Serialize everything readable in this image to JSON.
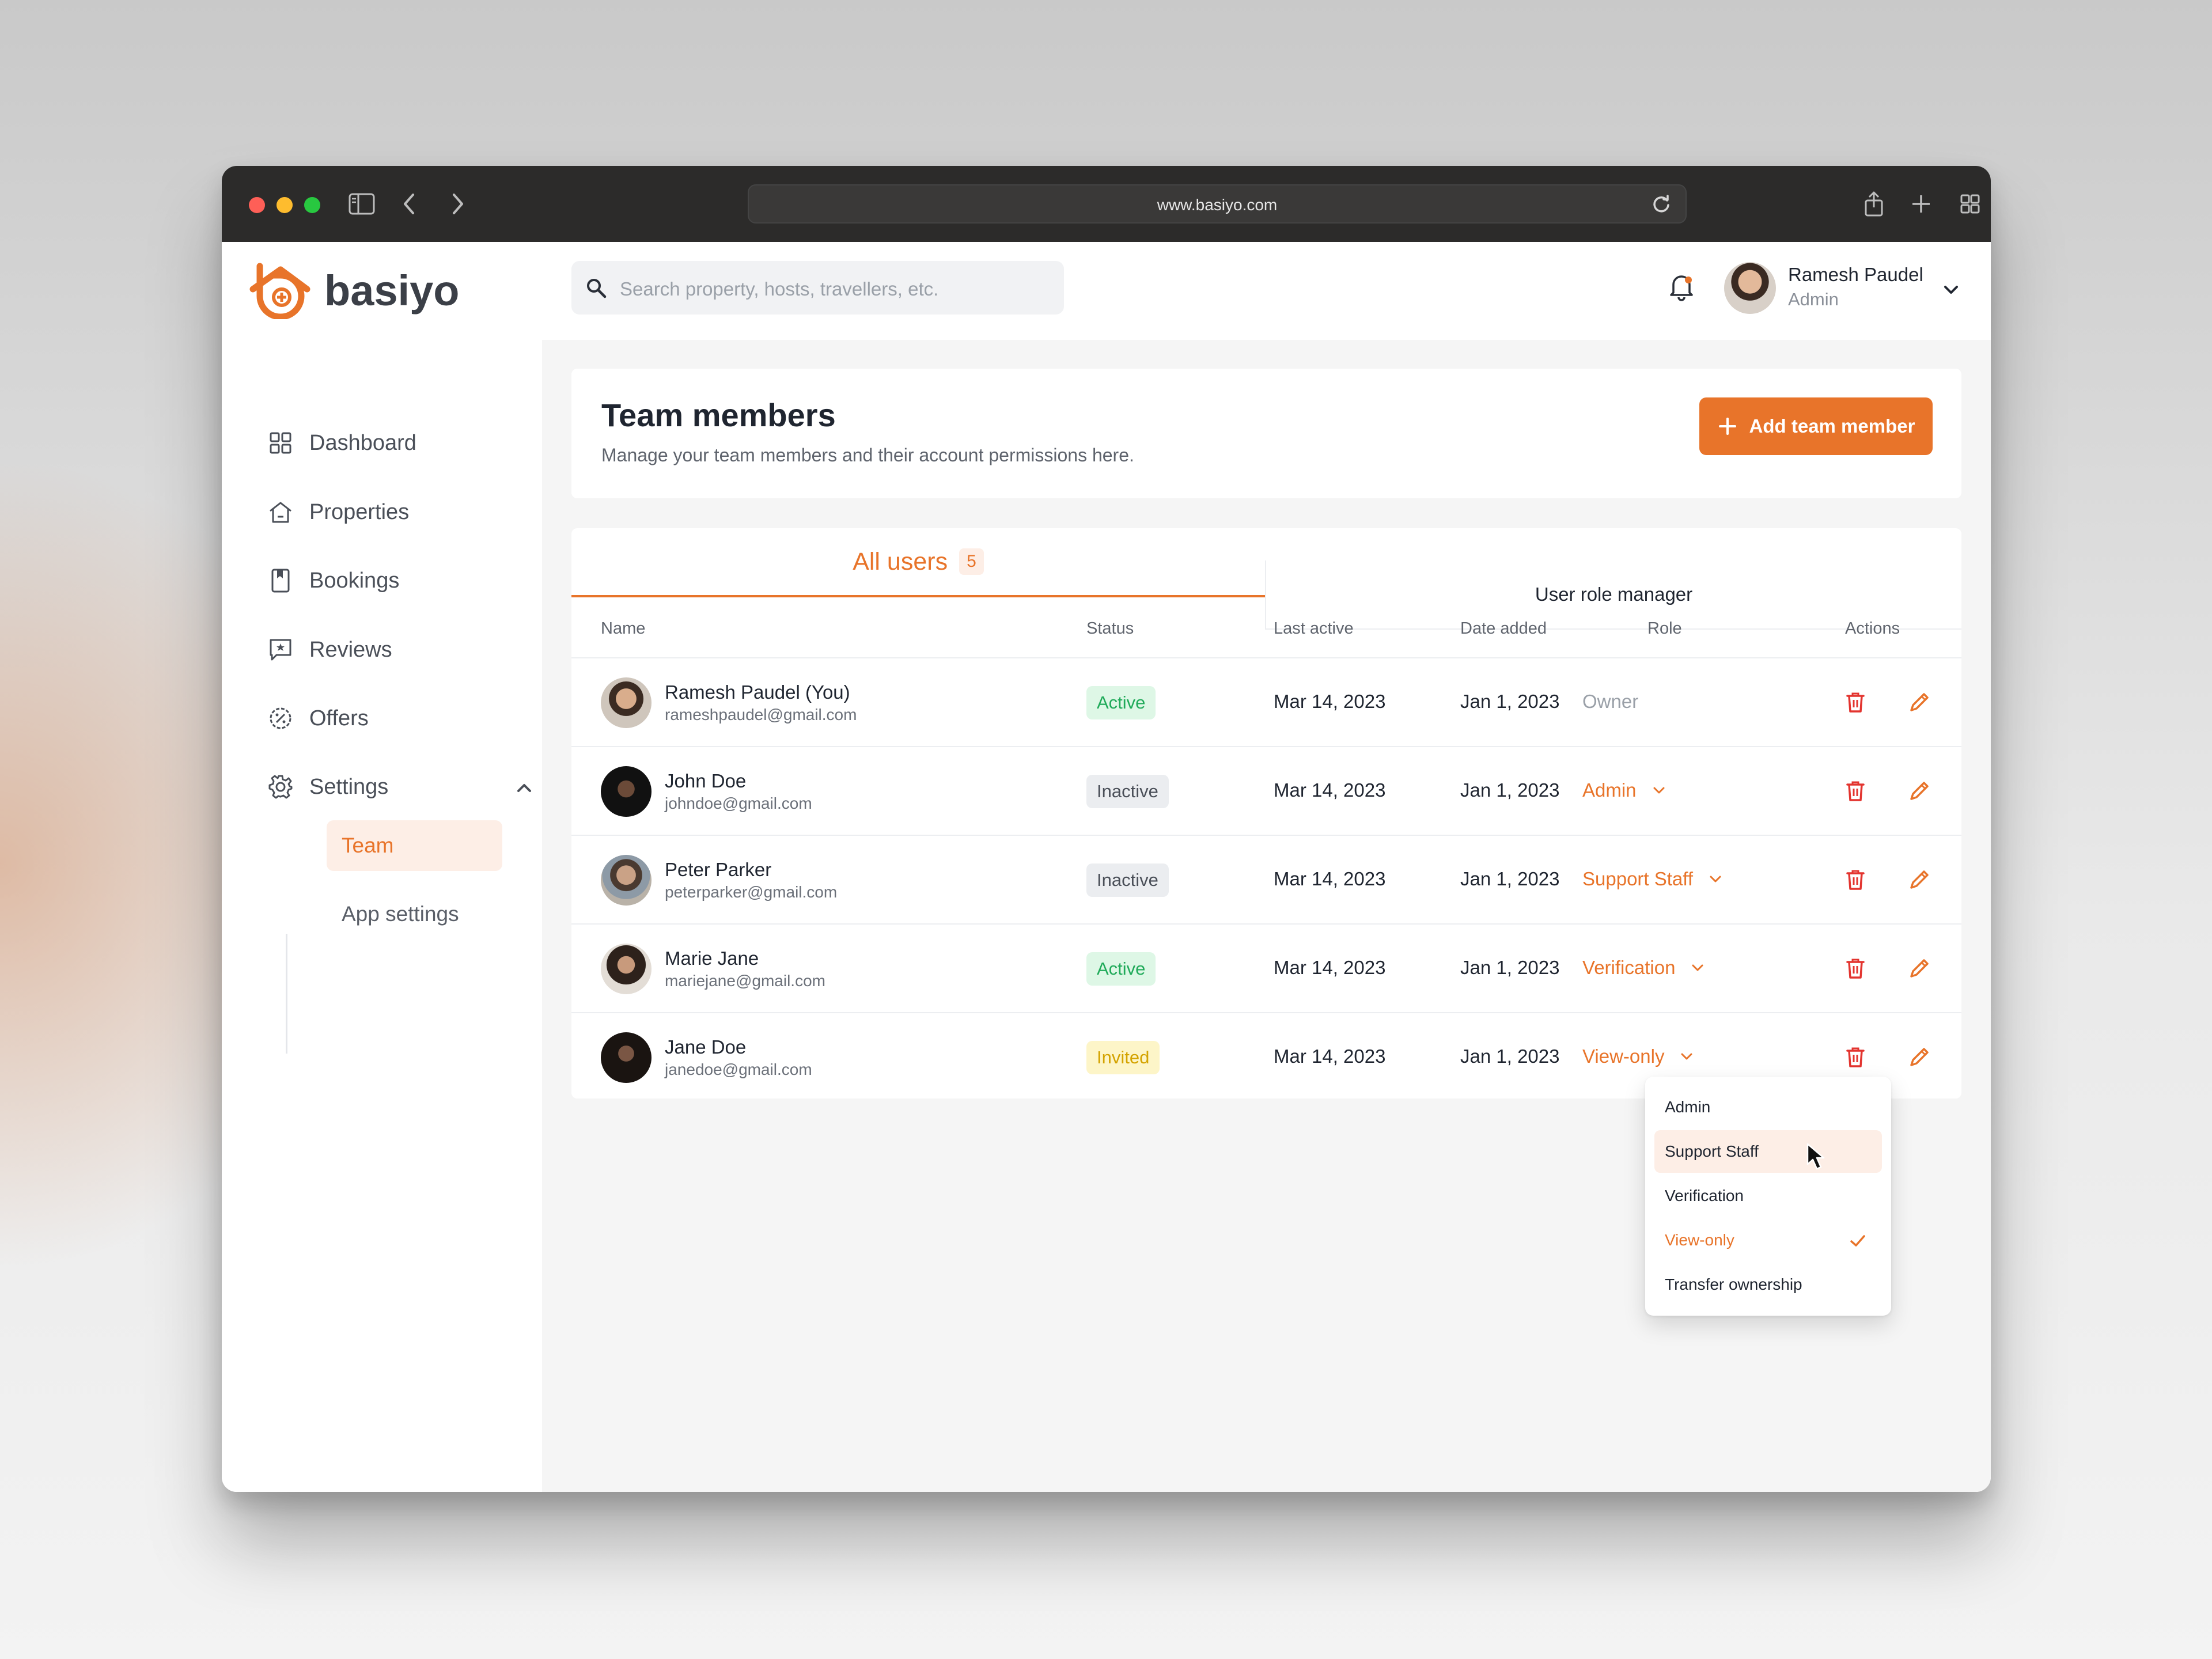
{
  "browser": {
    "url": "www.basiyo.com"
  },
  "brand": {
    "name": "basiyo",
    "accent": "#e8742a"
  },
  "search": {
    "placeholder": "Search property, hosts, travellers, etc."
  },
  "user": {
    "name": "Ramesh Paudel",
    "role": "Admin"
  },
  "sidebar": {
    "items": [
      {
        "label": "Dashboard",
        "icon": "dashboard-icon"
      },
      {
        "label": "Properties",
        "icon": "home-icon"
      },
      {
        "label": "Bookings",
        "icon": "bookmark-icon"
      },
      {
        "label": "Reviews",
        "icon": "review-icon"
      },
      {
        "label": "Offers",
        "icon": "offer-icon"
      },
      {
        "label": "Settings",
        "icon": "gear-icon"
      }
    ],
    "sub_items": [
      {
        "label": "Team",
        "active": true
      },
      {
        "label": "App settings",
        "active": false
      }
    ]
  },
  "page": {
    "title": "Team members",
    "subtitle": "Manage your team members and their account permissions here.",
    "add_button": "Add team member"
  },
  "tabs": {
    "all_users": "All users",
    "all_users_count": "5",
    "role_manager": "User role manager"
  },
  "table": {
    "headers": {
      "name": "Name",
      "status": "Status",
      "last_active": "Last active",
      "date_added": "Date added",
      "role": "Role",
      "actions": "Actions"
    },
    "rows": [
      {
        "name": "Ramesh Paudel (You)",
        "email": "rameshpaudel@gmail.com",
        "status": "Active",
        "last_active": "Mar 14, 2023",
        "date_added": "Jan 1, 2023",
        "role": "Owner"
      },
      {
        "name": "John Doe",
        "email": "johndoe@gmail.com",
        "status": "Inactive",
        "last_active": "Mar 14, 2023",
        "date_added": "Jan 1, 2023",
        "role": "Admin"
      },
      {
        "name": "Peter Parker",
        "email": "peterparker@gmail.com",
        "status": "Inactive",
        "last_active": "Mar 14, 2023",
        "date_added": "Jan 1, 2023",
        "role": "Support Staff"
      },
      {
        "name": "Marie Jane",
        "email": "mariejane@gmail.com",
        "status": "Active",
        "last_active": "Mar 14, 2023",
        "date_added": "Jan 1, 2023",
        "role": "Verification"
      },
      {
        "name": "Jane Doe",
        "email": "janedoe@gmail.com",
        "status": "Invited",
        "last_active": "Mar 14, 2023",
        "date_added": "Jan 1, 2023",
        "role": "View-only"
      }
    ]
  },
  "role_dropdown": {
    "options": [
      "Admin",
      "Support Staff",
      "Verification",
      "View-only",
      "Transfer ownership"
    ],
    "hovered": "Support Staff",
    "selected": "View-only"
  }
}
